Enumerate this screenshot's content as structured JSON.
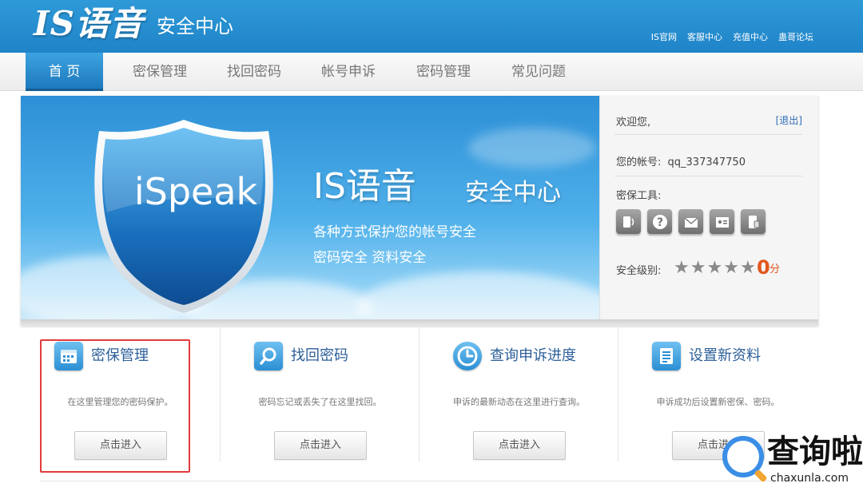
{
  "header": {
    "logo": "IS语音",
    "subtitle": "安全中心",
    "links": [
      "IS官网",
      "客服中心",
      "充值中心",
      "蛊哥论坛"
    ]
  },
  "nav": {
    "items": [
      "首 页",
      "密保管理",
      "找回密码",
      "帐号申诉",
      "密码管理",
      "常见问题"
    ],
    "active_index": 0
  },
  "banner": {
    "shield_text": "iSpeak",
    "title": "IS语音",
    "subtitle": "安全中心",
    "line1": "各种方式保护您的帐号安全",
    "line2": "密码安全  资料安全"
  },
  "user_panel": {
    "welcome": "欢迎您,",
    "logout": "[退出]",
    "account_label": "您的帐号:",
    "account_value": "qq_337347750",
    "tools_label": "密保工具:",
    "tools": [
      "phone-icon",
      "question-icon",
      "email-icon",
      "id-card-icon",
      "mobile-token-icon"
    ],
    "security_label": "安全级别:",
    "stars_total": 5,
    "score": "0",
    "score_unit": "分"
  },
  "cards": [
    {
      "icon": "calendar-icon",
      "title": "密保管理",
      "desc": "在这里管理您的密码保护。",
      "button": "点击进入"
    },
    {
      "icon": "search-icon",
      "title": "找回密码",
      "desc": "密码忘记或丢失了在这里找回。",
      "button": "点击进入"
    },
    {
      "icon": "clock-icon",
      "title": "查询申诉进度",
      "desc": "申诉的最新动态在这里进行查询。",
      "button": "点击进入"
    },
    {
      "icon": "document-icon",
      "title": "设置新资料",
      "desc": "申诉成功后设置新密保、密码。",
      "button": "点击进入"
    }
  ],
  "watermark": {
    "text": "查询啦",
    "url": "chaxunla.com"
  },
  "colors": {
    "header_blue": "#2f9ad8",
    "nav_active": "#1d79bd",
    "highlight_red": "#e23b3b",
    "score_orange": "#e2571e"
  }
}
